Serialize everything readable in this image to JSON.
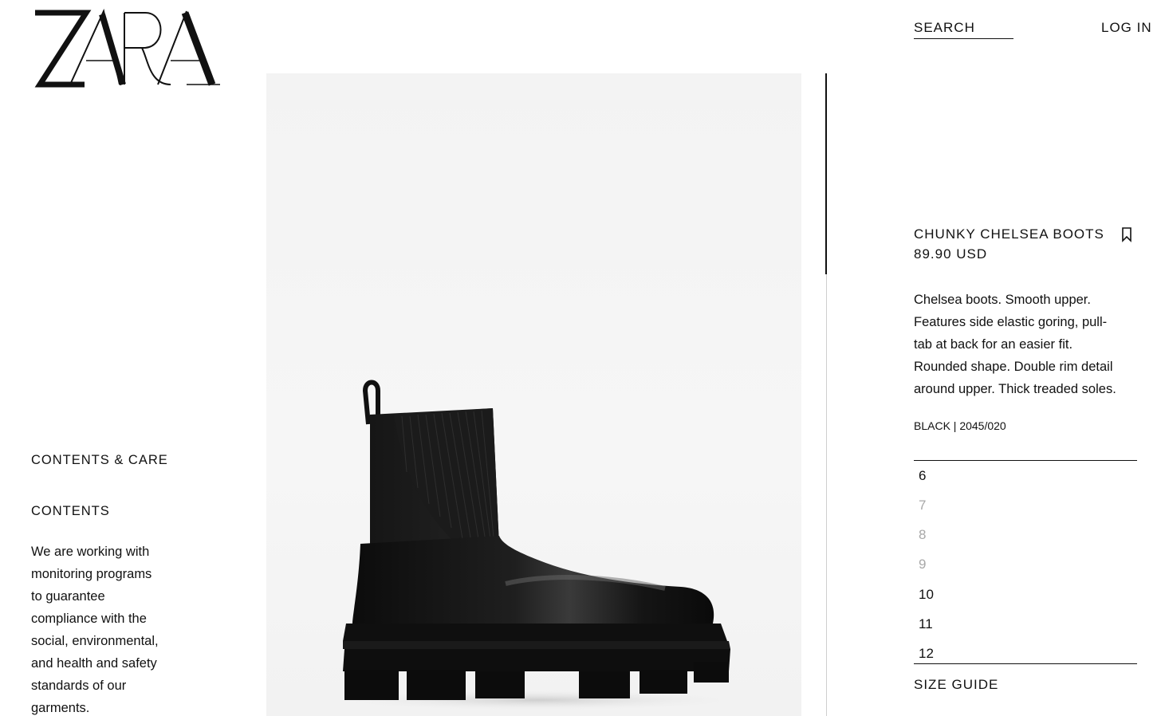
{
  "brand": {
    "logo_text": "ZARA"
  },
  "nav": {
    "search_label": "SEARCH",
    "login_label": "LOG IN"
  },
  "left_panel": {
    "contents_care_label": "CONTENTS & CARE",
    "contents_heading": "CONTENTS",
    "contents_lines": [
      "We are working with",
      "monitoring programs",
      "to guarantee",
      "compliance with the",
      "social, environmental,",
      "and health and safety",
      "standards of our",
      "garments."
    ]
  },
  "product": {
    "title": "CHUNKY CHELSEA BOOTS",
    "price": "89.90 USD",
    "description_lines": [
      "Chelsea boots. Smooth upper.",
      "Features side elastic goring, pull-",
      "tab at back for an easier fit.",
      "Rounded shape. Double rim detail",
      "around upper. Thick treaded soles."
    ],
    "color_ref": "BLACK | 2045/020",
    "image_subject": "black chunky chelsea boot"
  },
  "sizes": [
    {
      "label": "6",
      "available": true
    },
    {
      "label": "7",
      "available": false
    },
    {
      "label": "8",
      "available": false
    },
    {
      "label": "9",
      "available": false
    },
    {
      "label": "10",
      "available": true
    },
    {
      "label": "11",
      "available": true
    },
    {
      "label": "12",
      "available": true
    }
  ],
  "size_guide_label": "SIZE GUIDE",
  "icons": {
    "bookmark": "bookmark-icon",
    "logo": "zara-logo"
  },
  "colors": {
    "text": "#111111",
    "unavailable_size": "#a8a8a8",
    "background": "#ffffff"
  }
}
